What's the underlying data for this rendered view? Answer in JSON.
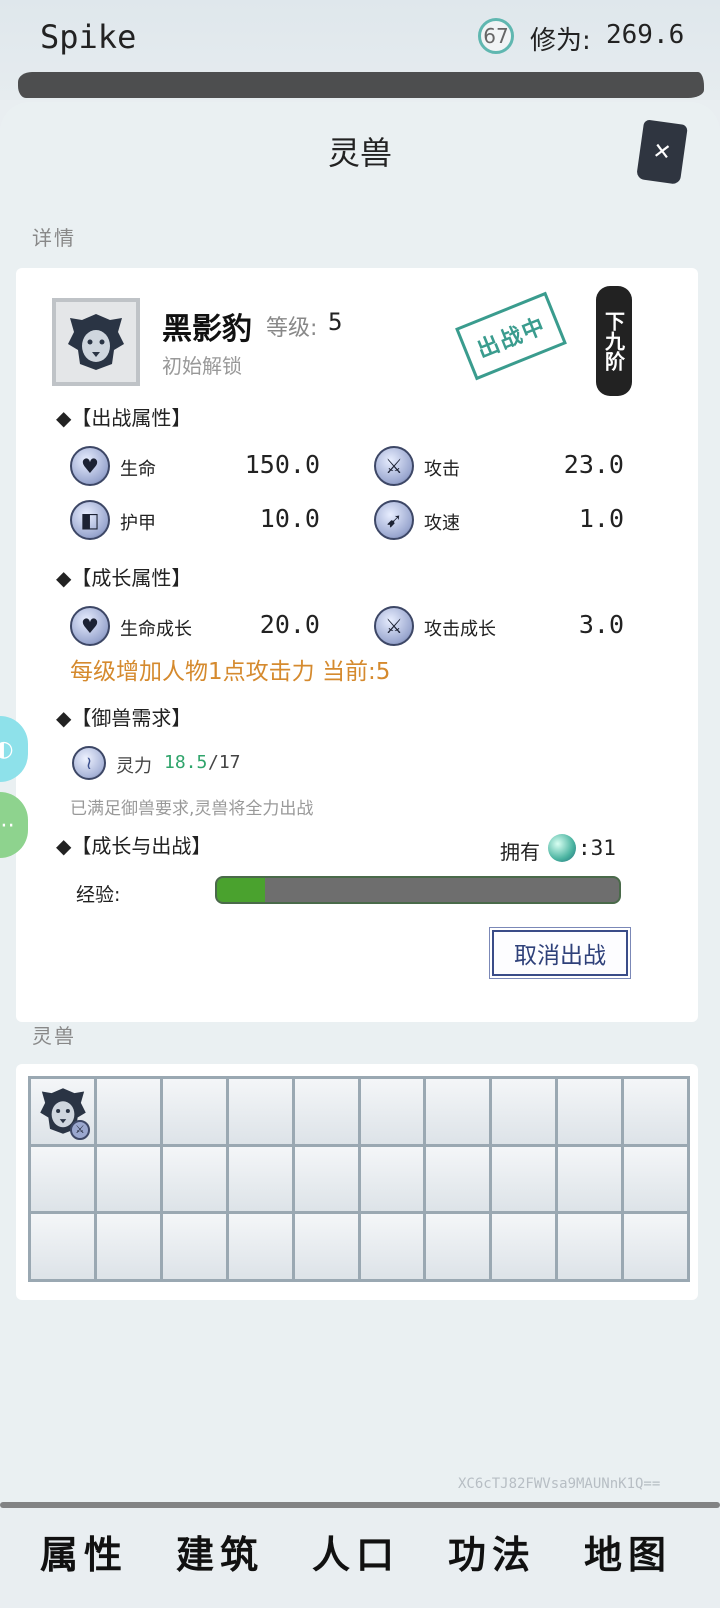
{
  "header": {
    "player_name": "Spike",
    "level": "67",
    "cultivation_label": "修为:",
    "cultivation_value": "269.6"
  },
  "panel": {
    "title": "灵兽",
    "close_icon": "close-icon",
    "details_section_label": "详情",
    "pets_section_label": "灵兽"
  },
  "pet": {
    "name": "黑影豹",
    "level_label": "等级:",
    "level_value": "5",
    "unlock_text": "初始解锁",
    "status_stamp": "出战中",
    "tier_badge": "下九阶",
    "portrait_icon": "lion-icon"
  },
  "combat_attrs": {
    "title": "◆【出战属性】",
    "items": [
      {
        "label": "生命",
        "value": "150.0",
        "icon": "heart-icon"
      },
      {
        "label": "攻击",
        "value": "23.0",
        "icon": "sword-icon"
      },
      {
        "label": "护甲",
        "value": "10.0",
        "icon": "shield-icon"
      },
      {
        "label": "攻速",
        "value": "1.0",
        "icon": "speed-icon"
      }
    ]
  },
  "growth_attrs": {
    "title": "◆【成长属性】",
    "items": [
      {
        "label": "生命成长",
        "value": "20.0",
        "icon": "heart-growth-icon"
      },
      {
        "label": "攻击成长",
        "value": "3.0",
        "icon": "sword-growth-icon"
      }
    ],
    "note": "每级增加人物1点攻击力 当前:5"
  },
  "taming": {
    "title": "◆【御兽需求】",
    "spirit_label": "灵力",
    "spirit_current": "18.5",
    "spirit_max": "/17",
    "note": "已满足御兽要求,灵兽将全力出战"
  },
  "progression": {
    "title": "◆【成长与出战】",
    "own_label": "拥有",
    "own_value": ":31",
    "exp_label": "经验:",
    "exp_fraction": 0.12,
    "cancel_label": "取消出战"
  },
  "grid": {
    "columns": 10,
    "rows": 3,
    "first_slot_icon": "lion-icon"
  },
  "device_code": "XC6cTJ82FWVsa9MAUNnK1Q==",
  "nav": {
    "items": [
      "属性",
      "建筑",
      "人口",
      "功法",
      "地图"
    ]
  },
  "colors": {
    "accent_orange": "#d58a2e",
    "spirit_green": "#2fa46b",
    "exp_green": "#4aa22e",
    "stamp_teal": "#3a9c8e",
    "button_blue": "#2f417a"
  }
}
